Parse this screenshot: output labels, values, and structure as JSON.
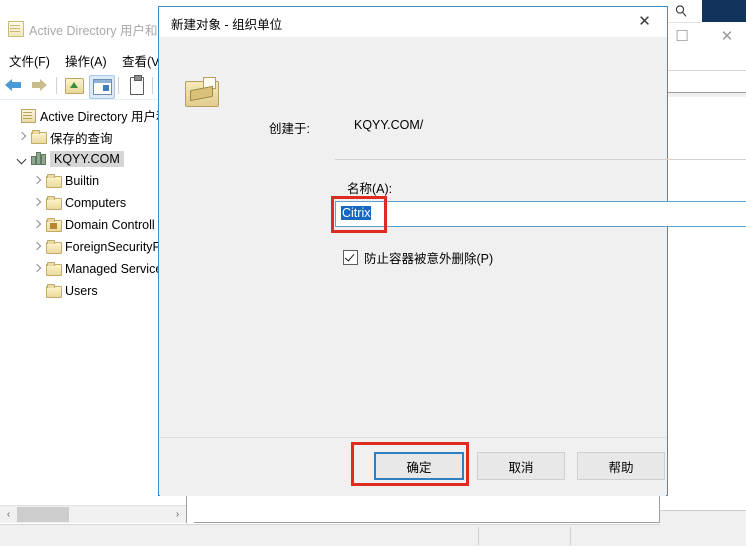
{
  "mmc": {
    "title": "Active Directory 用户和",
    "title_icon": "console-icon",
    "menus": [
      {
        "label": "文件(F)",
        "name": "menu-file"
      },
      {
        "label": "操作(A)",
        "name": "menu-action"
      },
      {
        "label": "查看(V)",
        "name": "menu-view"
      }
    ],
    "toolbar": [
      {
        "name": "back-arrow-icon"
      },
      {
        "name": "forward-arrow-icon"
      },
      {
        "name": "up-one-level-icon"
      },
      {
        "name": "show-hide-tree-icon"
      },
      {
        "name": "properties-icon"
      },
      {
        "name": "export-list-icon"
      }
    ],
    "tree": [
      {
        "label": "Active Directory 用户和i",
        "level": 0,
        "icon": "console-root-icon",
        "twisty": "none",
        "selected": false
      },
      {
        "label": "保存的查询",
        "level": 1,
        "icon": "folder-icon",
        "twisty": "collapsed",
        "selected": false
      },
      {
        "label": "KQYY.COM",
        "level": 1,
        "icon": "domain-icon",
        "twisty": "expanded",
        "selected": true
      },
      {
        "label": "Builtin",
        "level": 2,
        "icon": "folder-icon",
        "twisty": "collapsed",
        "selected": false
      },
      {
        "label": "Computers",
        "level": 2,
        "icon": "folder-icon",
        "twisty": "collapsed",
        "selected": false
      },
      {
        "label": "Domain Controll",
        "level": 2,
        "icon": "folder-dc-icon",
        "twisty": "collapsed",
        "selected": false
      },
      {
        "label": "ForeignSecurityP",
        "level": 2,
        "icon": "folder-icon",
        "twisty": "collapsed",
        "selected": false
      },
      {
        "label": "Managed Service",
        "level": 2,
        "icon": "folder-icon",
        "twisty": "collapsed",
        "selected": false
      },
      {
        "label": "Users",
        "level": 2,
        "icon": "folder-icon",
        "twisty": "none",
        "selected": false
      }
    ],
    "scroll": {
      "left_arrow": "‹",
      "right_arrow": "›"
    }
  },
  "dialog": {
    "title": "新建对象 - 组织单位",
    "close_label": "✕",
    "ou_icon": "organizational-unit-icon",
    "created_in_label": "创建于:",
    "created_in_value": "KQYY.COM/",
    "name_label": "名称(A):",
    "name_value": "Citrix",
    "protect_checkbox_label": "防止容器被意外删除(P)",
    "protect_checkbox_checked": true,
    "buttons": {
      "ok": "确定",
      "cancel": "取消",
      "help": "帮助"
    }
  },
  "background_window": {
    "search_icon": "search-icon",
    "maximize_label": "☐",
    "close_label": "✕"
  },
  "colors": {
    "accent_blue": "#2c7fc0",
    "highlight_red": "#e02b20",
    "selection_blue": "#1669c0",
    "dialog_bg": "#f0f0f0",
    "navy": "#11335c"
  }
}
